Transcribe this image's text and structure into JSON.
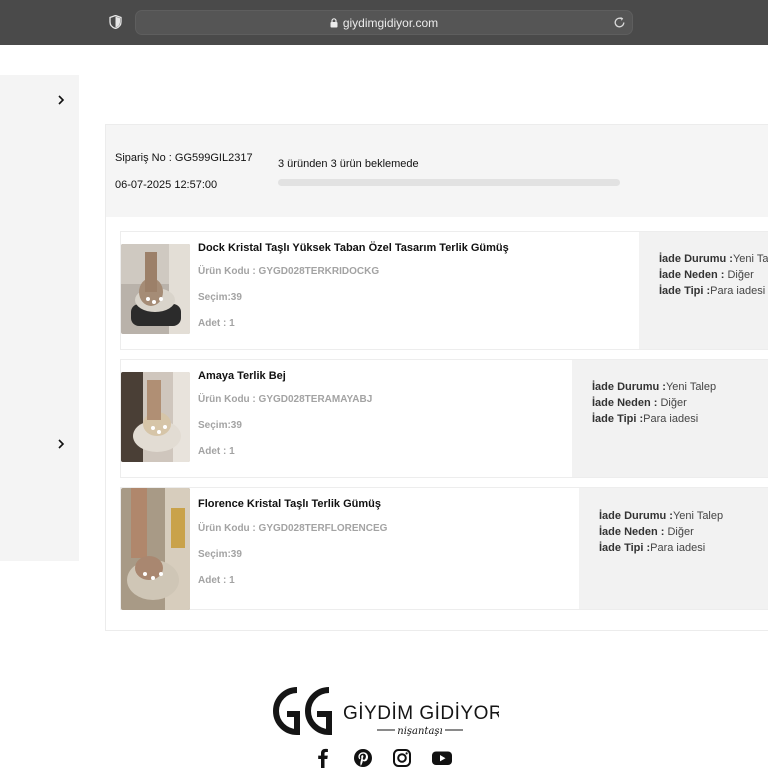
{
  "browser": {
    "url": "giydimgidiyor.com"
  },
  "order": {
    "number_label": "Sipariş No : GG599GIL2317",
    "date": "06-07-2025 12:57:00",
    "status": "3 üründen 3 ürün beklemede",
    "progress": 0
  },
  "items": [
    {
      "title": "Dock Kristal Taşlı Yüksek Taban Özel Tasarım Terlik Gümüş",
      "code": "Ürün Kodu : GYGD028TERKRIDOCKG",
      "selection": "Seçim:39",
      "quantity": "Adet : 1",
      "return_status_label": "İade Durumu :",
      "return_status": "Yeni Talep",
      "return_reason_label": "İade Neden :",
      "return_reason": "Diğer",
      "return_type_label": "İade Tipi :",
      "return_type": "Para iadesi"
    },
    {
      "title": "Amaya Terlik Bej",
      "code": "Ürün Kodu : GYGD028TERAMAYABJ",
      "selection": "Seçim:39",
      "quantity": "Adet : 1",
      "return_status_label": "İade Durumu :",
      "return_status": "Yeni Talep",
      "return_reason_label": "İade Neden :",
      "return_reason": "Diğer",
      "return_type_label": "İade Tipi :",
      "return_type": "Para iadesi"
    },
    {
      "title": "Florence Kristal Taşlı Terlik Gümüş",
      "code": "Ürün Kodu : GYGD028TERFLORENCEG",
      "selection": "Seçim:39",
      "quantity": "Adet : 1",
      "return_status_label": "İade Durumu :",
      "return_status": "Yeni Talep",
      "return_reason_label": "İade Neden :",
      "return_reason": "Diğer",
      "return_type_label": "İade Tipi :",
      "return_type": "Para iadesi"
    }
  ],
  "footer": {
    "brand": "GİYDİM GİDİYOR",
    "tagline": "nişantaşı",
    "social": [
      "facebook-icon",
      "pinterest-icon",
      "instagram-icon",
      "youtube-icon"
    ]
  },
  "colors": {
    "chrome": "#4a4a4a",
    "panel": "#f5f5f5",
    "muted_text": "#a3a3a3"
  }
}
